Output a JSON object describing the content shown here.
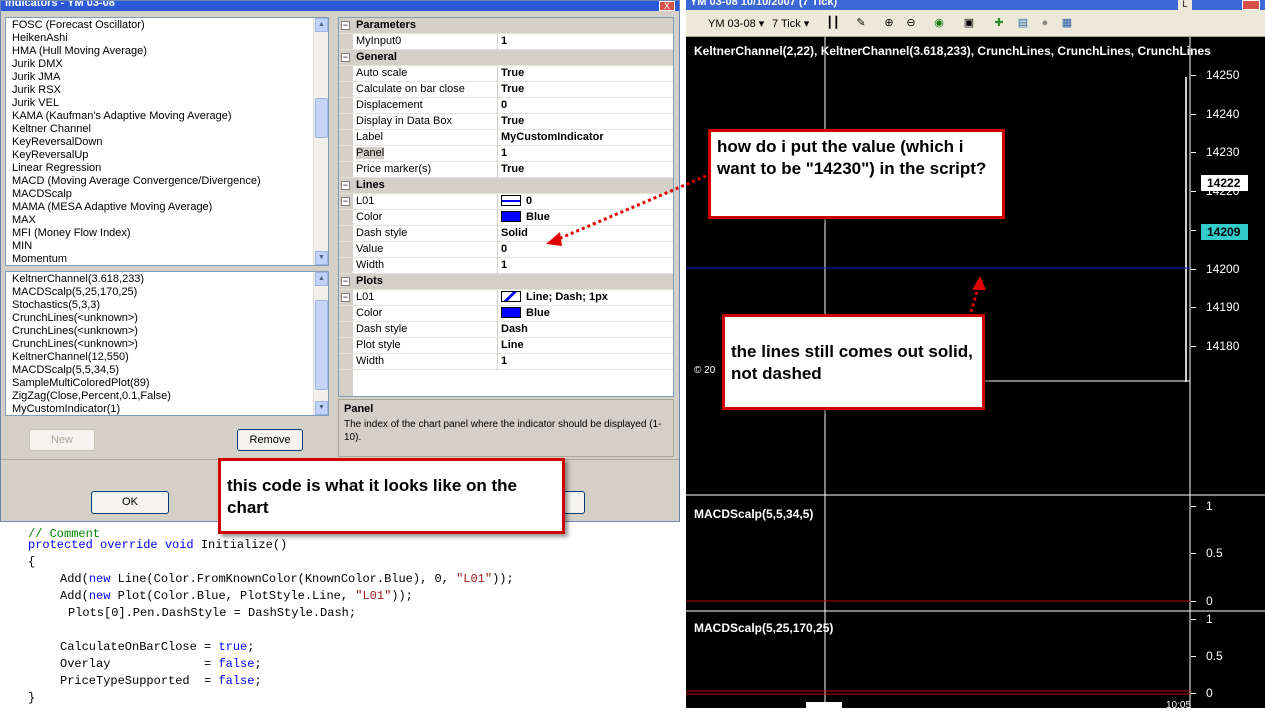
{
  "dialog": {
    "title": "Indicators - YM 03-08",
    "close_glyph": "X",
    "available": [
      "FOSC (Forecast Oscillator)",
      "HeikenAshi",
      "HMA (Hull Moving Average)",
      "Jurik DMX",
      "Jurik JMA",
      "Jurik RSX",
      "Jurik VEL",
      "KAMA (Kaufman's Adaptive Moving Average)",
      "Keltner Channel",
      "KeyReversalDown",
      "KeyReversalUp",
      "Linear Regression",
      "MACD (Moving Average Convergence/Divergence)",
      "MACDScalp",
      "MAMA (MESA Adaptive Moving Average)",
      "MAX",
      "MFI (Money Flow Index)",
      "MIN",
      "Momentum"
    ],
    "applied": [
      "KeltnerChannel(3.618,233)",
      "MACDScalp(5,25,170,25)",
      "Stochastics(5,3,3)",
      "CrunchLines(<unknown>)",
      "CrunchLines(<unknown>)",
      "CrunchLines(<unknown>)",
      "KeltnerChannel(12,550)",
      "MACDScalp(5,5,34,5)",
      "SampleMultiColoredPlot(89)",
      "ZigZag(Close,Percent,0.1,False)",
      "MyCustomIndicator(1)"
    ],
    "new_label": "New",
    "remove_label": "Remove",
    "ok_label": "OK",
    "props": [
      {
        "cat": true,
        "name": "Parameters"
      },
      {
        "name": "MyInput0",
        "value": "1"
      },
      {
        "cat": true,
        "name": "General"
      },
      {
        "name": "Auto scale",
        "value": "True"
      },
      {
        "name": "Calculate on bar close",
        "value": "True"
      },
      {
        "name": "Displacement",
        "value": "0"
      },
      {
        "name": "Display in Data Box",
        "value": "True"
      },
      {
        "name": "Label",
        "value": "MyCustomIndicator"
      },
      {
        "name": "Panel",
        "value": "1"
      },
      {
        "name": "Price marker(s)",
        "value": "True"
      },
      {
        "cat": true,
        "name": "Lines"
      },
      {
        "name": "L01",
        "value": "0",
        "expander": true,
        "swatch": "line"
      },
      {
        "name": "Color",
        "value": "Blue",
        "indent": true,
        "swatch": "blue"
      },
      {
        "name": "Dash style",
        "value": "Solid",
        "indent": true
      },
      {
        "name": "Value",
        "value": "0",
        "indent": true
      },
      {
        "name": "Width",
        "value": "1",
        "indent": true
      },
      {
        "cat": true,
        "name": "Plots"
      },
      {
        "name": "L01",
        "value": "Line; Dash; 1px",
        "expander": true,
        "swatch": "plot"
      },
      {
        "name": "Color",
        "value": "Blue",
        "indent": true,
        "swatch": "blue"
      },
      {
        "name": "Dash style",
        "value": "Dash",
        "indent": true
      },
      {
        "name": "Plot style",
        "value": "Line",
        "indent": true
      },
      {
        "name": "Width",
        "value": "1",
        "indent": true
      }
    ],
    "help_title": "Panel",
    "help_text": "The index of the chart panel where the indicator should be displayed (1-10)."
  },
  "code": {
    "partial_line": "// Comment",
    "signature": "protected override void Initialize()",
    "open_brace": "{",
    "line1": "Add(new Line(Color.FromKnownColor(KnownColor.Blue), 0, \"L01\"));",
    "line2": "Add(new Plot(Color.Blue, PlotStyle.Line, \"L01\"));",
    "line3": "Plots[0].Pen.DashStyle = DashStyle.Dash;",
    "line4": "CalculateOnBarClose = true;",
    "line5": "Overlay             = false;",
    "line6": "PriceTypeSupported  = false;",
    "close_brace": "}"
  },
  "chart": {
    "title": "YM 03-08   10/10/2007   (7 Tick)",
    "window_btn": "L",
    "instrument": "YM 03-08",
    "interval": "7 Tick",
    "main_label": "KeltnerChannel(2,22),  KeltnerChannel(3.618,233),  CrunchLines,  CrunchLines,  CrunchLines",
    "price_ticks": [
      "14250",
      "14240",
      "14230",
      "14220",
      "14210",
      "14200",
      "14190",
      "14180"
    ],
    "marker_white": "14222",
    "marker_cyan": "14209",
    "copyright": "© 20",
    "panel2_label": "MACDScalp(5,5,34,5)",
    "panel2_ticks": [
      "1",
      "0.5",
      "0"
    ],
    "panel3_label": "MACDScalp(5,25,170,25)",
    "panel3_ticks": [
      "1",
      "0.5",
      "0"
    ],
    "bottom_time": "10:05",
    "colors": {
      "hline": "#2020c0",
      "zero": "#c00000",
      "cyan": "#33cccc"
    }
  },
  "callouts": {
    "question": "how do i  put the value (which i want to be \"14230\") in the script?",
    "lines_solid": "the lines still comes  out solid, not dashed",
    "code_note": "this code is what it looks like on the chart"
  }
}
